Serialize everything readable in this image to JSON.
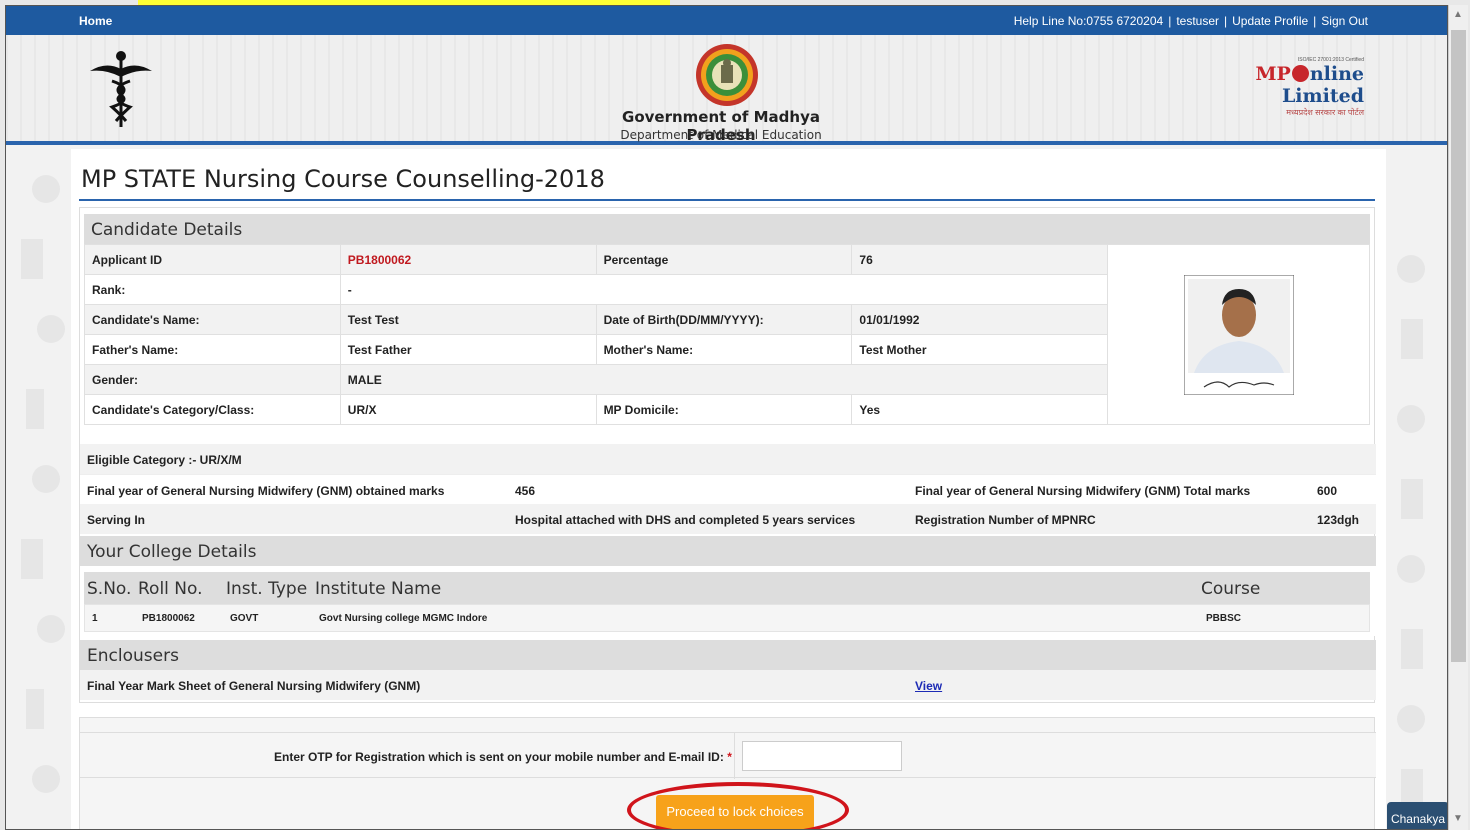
{
  "topbar": {
    "home": "Home",
    "helpline": "Help Line No:0755 6720204",
    "sep1": "|",
    "user": "testuser",
    "sep2": "|",
    "update_profile": "Update Profile",
    "sep3": "|",
    "sign_out": "Sign Out"
  },
  "header": {
    "gov_title": "Government of Madhya Pradesh",
    "dept": "Department of Medical Education",
    "mponline_cert": "ISO/IEC 27001:2013 Certified",
    "mponline_brand_mp": "MP",
    "mponline_brand_rest": "nline Limited",
    "mponline_tag": "मध्यप्रदेश सरकार का पोर्टल"
  },
  "page": {
    "title": "MP STATE Nursing Course Counselling-2018"
  },
  "candidate": {
    "section_title": "Candidate Details",
    "applicant_id_label": "Applicant ID",
    "applicant_id": "PB1800062",
    "percentage_label": "Percentage",
    "percentage": "76",
    "rank_label": "Rank:",
    "rank": "-",
    "name_label": "Candidate's Name:",
    "name": "Test Test",
    "dob_label": "Date of Birth(DD/MM/YYYY):",
    "dob": "01/01/1992",
    "father_label": "Father's Name:",
    "father": "Test Father",
    "mother_label": "Mother's Name:",
    "mother": "Test Mother",
    "gender_label": "Gender:",
    "gender": "MALE",
    "category_label": "Candidate's Category/Class:",
    "category": "UR/X",
    "domicile_label": "MP Domicile:",
    "domicile": "Yes"
  },
  "eligibility": {
    "eligible_category": "Eligible Category :- UR/X/M",
    "gnm_obtained_label": "Final year of General Nursing Midwifery (GNM) obtained marks",
    "gnm_obtained": "456",
    "gnm_total_label": "Final year of General Nursing Midwifery (GNM) Total marks",
    "gnm_total": "600",
    "serving_label": "Serving In",
    "serving": "Hospital attached with DHS and completed 5 years services",
    "mpnrc_label": "Registration Number of MPNRC",
    "mpnrc": "123dgh"
  },
  "college": {
    "section_title": "Your College Details",
    "headers": {
      "sno": "S.No.",
      "roll": "Roll No.",
      "inst_type": "Inst. Type",
      "inst_name": "Institute Name",
      "course": "Course"
    },
    "row": {
      "sno": "1",
      "roll": "PB1800062",
      "inst_type": "GOVT",
      "inst_name": "Govt Nursing college MGMC Indore",
      "course": "PBBSC"
    }
  },
  "enclosures": {
    "section_title": "Enclousers",
    "item_label": "Final Year Mark Sheet of General Nursing Midwifery (GNM)",
    "view_link": "View"
  },
  "otp": {
    "label": "Enter OTP for Registration which is sent on your mobile number and E-mail ID:",
    "required_mark": "*",
    "value": ""
  },
  "actions": {
    "proceed_label": "Proceed to lock choices"
  },
  "widget": {
    "chanakya": "Chanakya"
  },
  "colors": {
    "topbar": "#1e5aa0",
    "accent_button": "#f7a21a",
    "annotation_red": "#d0141b",
    "applicant_id_red": "#c0191f"
  },
  "icons": [
    "caduceus-icon",
    "mp-emblem-icon",
    "candidate-photo",
    "scroll-up-icon",
    "scroll-down-icon"
  ]
}
